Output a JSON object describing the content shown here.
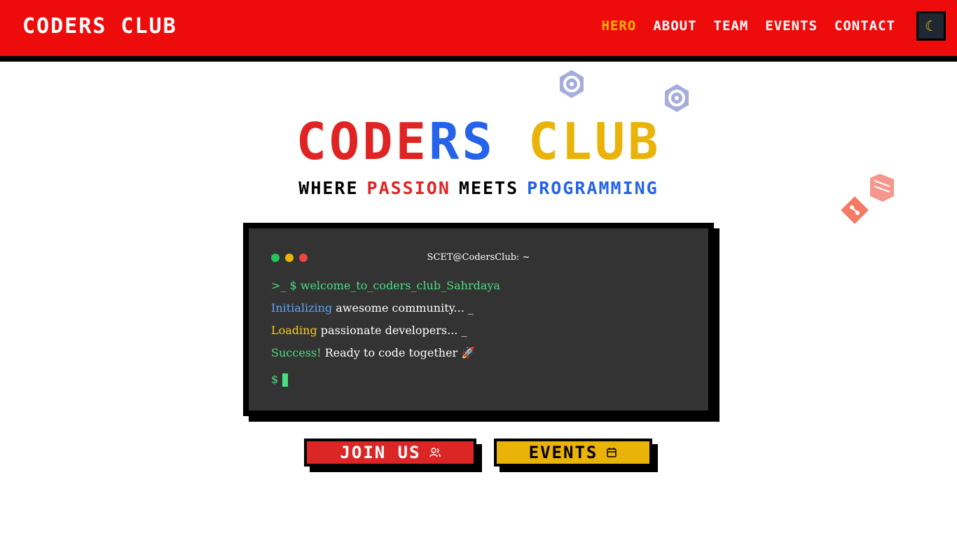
{
  "header": {
    "brand": "CODERS CLUB",
    "nav": [
      "HERO",
      "ABOUT",
      "TEAM",
      "EVENTS",
      "CONTACT"
    ],
    "active_nav": "HERO",
    "theme_icon": "moon-icon"
  },
  "hero": {
    "title_parts": [
      "CODE",
      "RS",
      "CLUB"
    ],
    "subtitle_parts": [
      "WHERE",
      "PASSION",
      "MEETS",
      "PROGRAMMING"
    ]
  },
  "terminal": {
    "title": "SCET@CodersClub: ~",
    "prompt": ">_ $",
    "command": "welcome_to_coders_club_Sahrdaya",
    "lines": [
      {
        "keyword": "Initializing",
        "text": "awesome community... _"
      },
      {
        "keyword": "Loading",
        "text": "passionate developers... _"
      },
      {
        "keyword": "Success!",
        "text": "Ready to code together 🚀"
      }
    ],
    "cursor_prompt": "$"
  },
  "buttons": {
    "join": "JOIN US",
    "events": "EVENTS"
  },
  "colors": {
    "brand_red": "#ee0b0b",
    "accent_yellow": "#eab308",
    "accent_blue": "#2563eb",
    "terminal_bg": "#333333",
    "terminal_green": "#4ade80"
  }
}
